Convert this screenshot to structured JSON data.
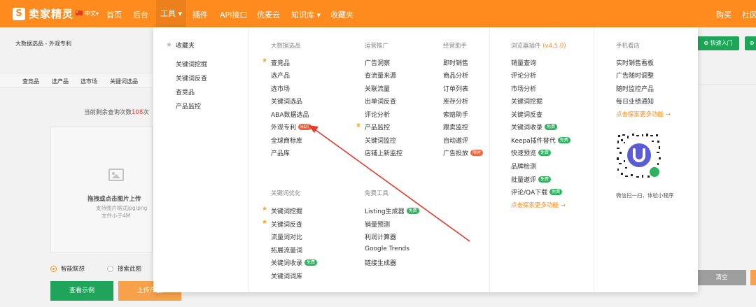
{
  "topbar": {
    "logo_mark": "S",
    "brand": "卖家精灵",
    "lang": "中文",
    "nav": [
      "首页",
      "后台",
      "工具",
      "插件",
      "API接口",
      "优麦云",
      "知识库",
      "收藏夹"
    ],
    "right": [
      "购买",
      "社区"
    ]
  },
  "page": {
    "breadcrumb": "大数据选品 - 外观专利",
    "subtabs": [
      "查竞品",
      "选产品",
      "选市场",
      "关键词选品"
    ],
    "quota_prefix": "当前剩余查询次数",
    "quota_value": "108",
    "quota_suffix": "次",
    "upload_title": "拖拽或点击图片上传",
    "upload_hint1": "支持图片格式jpg/png",
    "upload_hint2": "文件小于4M",
    "radio_smart": "智能联想",
    "radio_search": "搜索此图",
    "btn_example": "查看示例",
    "btn_upload": "上传产品",
    "quick_entry": "快速入门",
    "clear": "清空"
  },
  "dropdown": {
    "favorites": {
      "title": "收藏夹",
      "items": [
        "关键词挖掘",
        "关键词反查",
        "查竞品",
        "产品监控"
      ]
    },
    "bigdata": {
      "title": "大数据选品",
      "items": [
        "查竞品",
        "选产品",
        "选市场",
        "关键词选品",
        "ABA数据选品",
        "外观专利",
        "全球商标库",
        "产品库"
      ],
      "hot_badge": "HOT"
    },
    "ads": {
      "title": "运营推广",
      "items": [
        "广告洞察",
        "查流量来源",
        "关联流量",
        "出单词反查",
        "评论分析",
        "产品监控",
        "关键词监控",
        "店铺上新监控"
      ]
    },
    "ops": {
      "title": "经营助手",
      "items": [
        "即时销售",
        "商品分析",
        "订单列表",
        "库存分析",
        "索赔助手",
        "跟卖监控",
        "自动邀评",
        "广告投放"
      ],
      "new_badge": "限时"
    },
    "kw": {
      "title": "关键词优化",
      "items": [
        "关键词挖掘",
        "关键词反查",
        "流量词对比",
        "拓展流量词",
        "关键词收录",
        "关键词词库"
      ]
    },
    "free": {
      "title": "免费工具",
      "items": [
        "Listing生成器",
        "销量预测",
        "利润计算器",
        "Google Trends",
        "链接生成器"
      ]
    },
    "plugin": {
      "title_prefix": "浏览器插件",
      "version": "(v4.5.0)",
      "items": [
        "销量查询",
        "评论分析",
        "市场分析",
        "关键词挖掘",
        "关键词反查",
        "关键词收录",
        "Keepa插件替代",
        "快速预览",
        "品牌检测",
        "批量邀评",
        "评论/QA下载"
      ],
      "more": "点击探索更多功能 →"
    },
    "mobile": {
      "title": "手机看店",
      "items": [
        "实时销售看板",
        "广告随时调整",
        "随时监控产品",
        "每日业绩通知"
      ],
      "more": "点击探索更多功能 →",
      "qr_caption": "微信扫一扫，体验小程序"
    },
    "free_badge": "免费"
  },
  "colors": {
    "brand_orange": "#ff8b1f",
    "green": "#1fa55a",
    "star": "#f5a623",
    "arrow": "#e53a2e"
  }
}
